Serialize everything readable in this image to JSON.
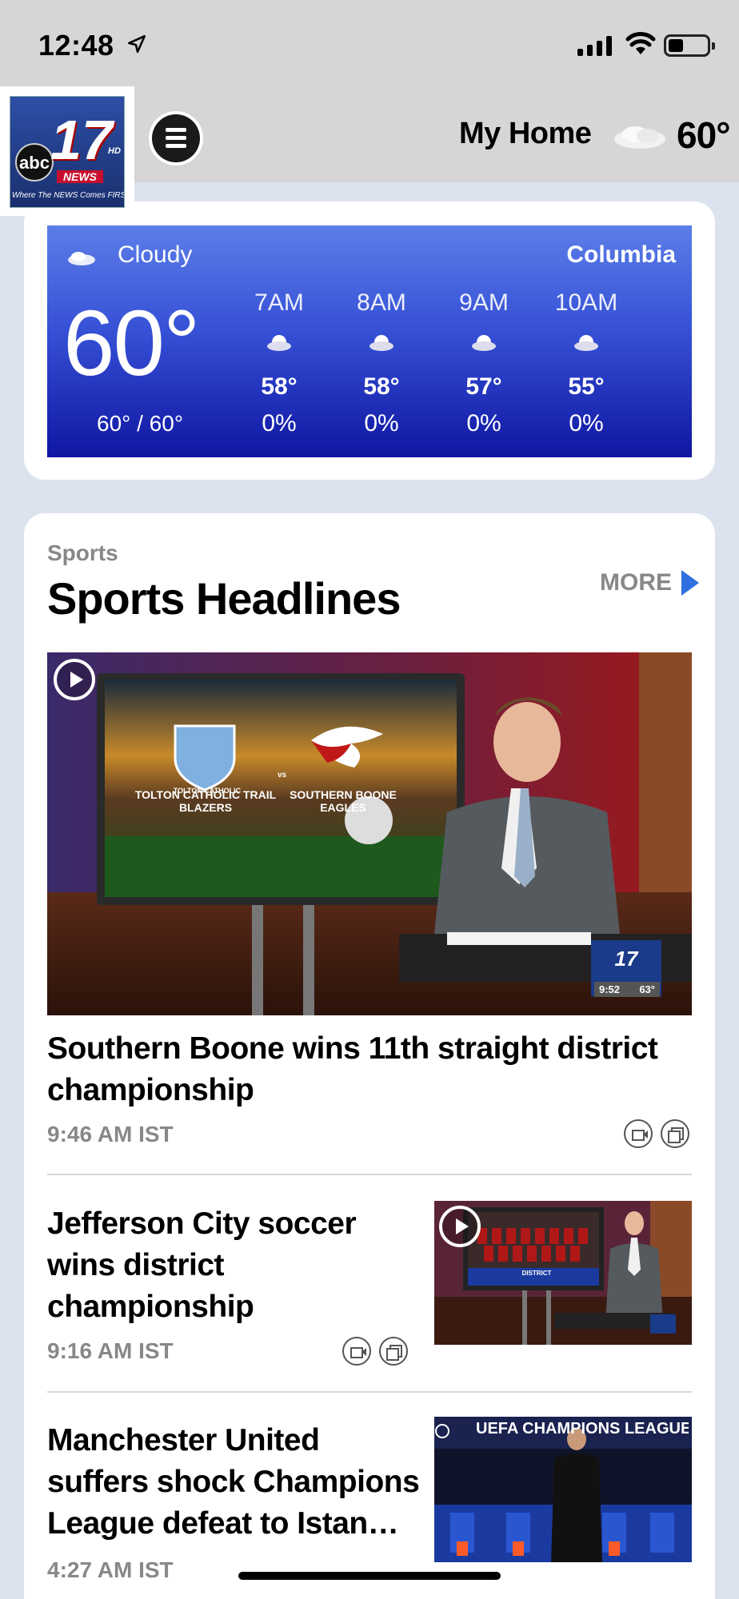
{
  "status_bar": {
    "time": "12:48"
  },
  "header": {
    "logo": {
      "network": "abc",
      "channel": "17",
      "hd": "HD",
      "news": "NEWS",
      "tagline": "Where The NEWS Comes FIRST"
    },
    "title": "My Home",
    "temp": "60°"
  },
  "weather": {
    "condition": "Cloudy",
    "city": "Columbia",
    "current_temp": "60°",
    "hi_lo": "60° / 60°",
    "hourly": [
      {
        "time": "7AM",
        "temp": "58°",
        "precip": "0%"
      },
      {
        "time": "8AM",
        "temp": "58°",
        "precip": "0%"
      },
      {
        "time": "9AM",
        "temp": "57°",
        "precip": "0%"
      },
      {
        "time": "10AM",
        "temp": "55°",
        "precip": "0%"
      }
    ]
  },
  "sports": {
    "section_label": "Sports",
    "title": "Sports Headlines",
    "more": "MORE",
    "hero": {
      "team1": "TOLTON CATHOLIC TRAIL BLAZERS",
      "team1_badge": "TOLTON CATHOLIC",
      "vs": "vs",
      "team2": "SOUTHERN BOONE EAGLES",
      "bug_time": "9:52",
      "bug_temp": "63°"
    },
    "articles": [
      {
        "headline": "Southern Boone wins 11th straight district championship",
        "time": "9:46 AM IST"
      },
      {
        "headline": "Jefferson City soccer wins district championship",
        "time": "9:16 AM IST",
        "thumb_caption": "DISTRICT"
      },
      {
        "headline": "Manchester United suffers shock Champions League defeat to Istan…",
        "time": "4:27 AM IST",
        "thumb_caption": "UEFA CHAMPIONS LEAGUE"
      }
    ]
  }
}
